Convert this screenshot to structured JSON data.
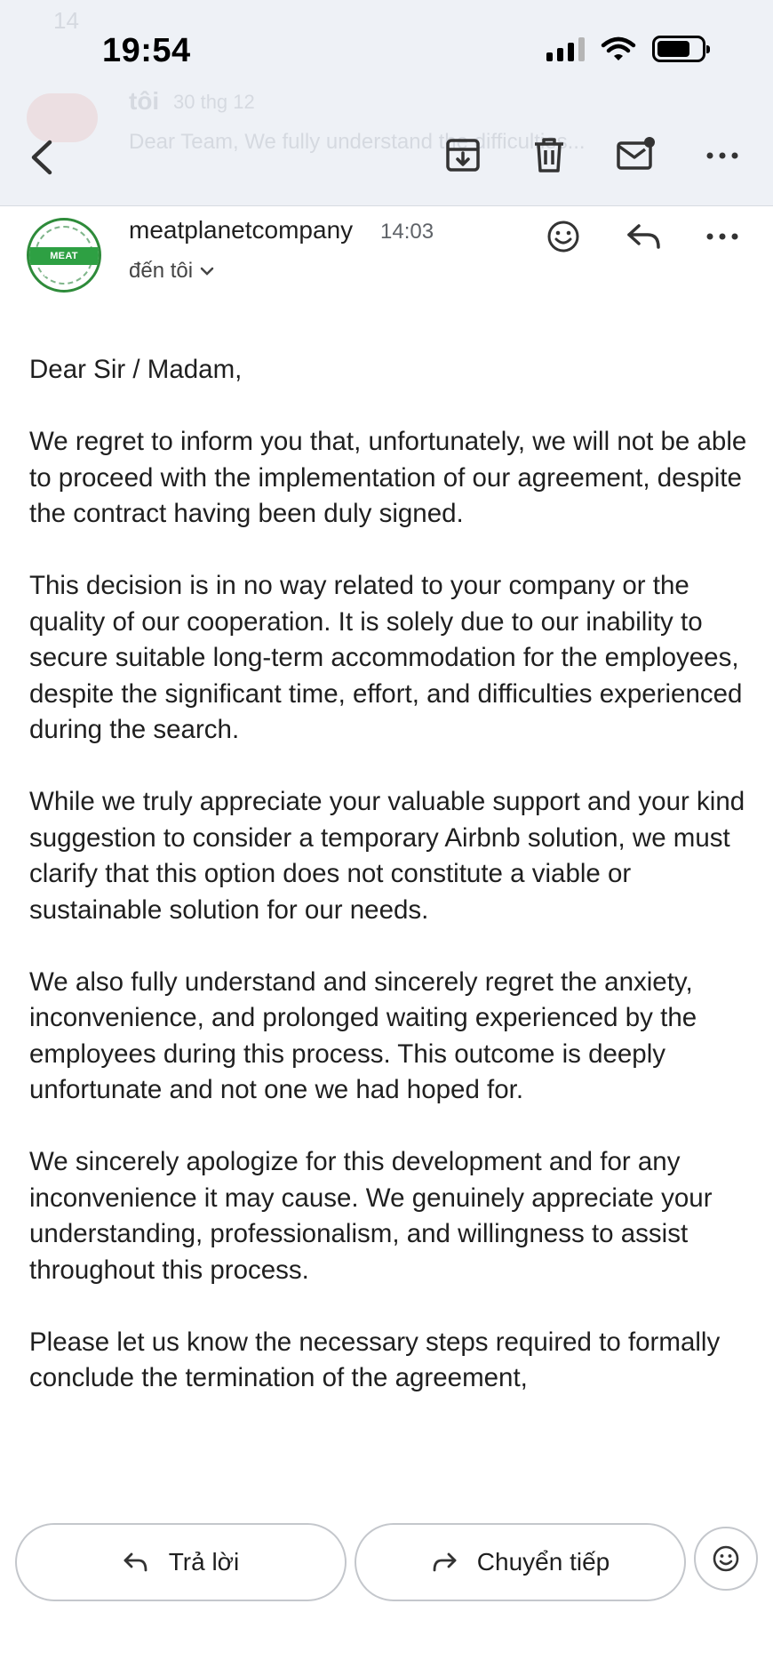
{
  "status_bar": {
    "time": "19:54"
  },
  "background_preview": {
    "count": "14",
    "sender": "tôi",
    "date": "30 thg 12",
    "snippet": "Dear Team, We fully understand the difficulties..."
  },
  "sender": {
    "name": "meatplanetcompany",
    "time": "14:03",
    "recipient_label": "đến tôi",
    "logo_text": "MEAT PLANET"
  },
  "body": {
    "paragraphs": [
      "Dear Sir / Madam,",
      "We regret to inform you that, unfortunately, we will not be able to proceed with the implementation of our agreement, despite the contract having been duly signed.",
      "This decision is in no way related to your company or the quality of our cooperation. It is solely due to our inability to secure suitable long-term accommodation for the employees, despite the significant time, effort, and difficulties experienced during the search.",
      "While we truly appreciate your valuable support and your kind suggestion to consider a temporary Airbnb solution, we must clarify that this option does not constitute a viable or sustainable solution for our needs.",
      "We also fully understand and sincerely regret the anxiety, inconvenience, and prolonged waiting experienced by the employees during this process. This outcome is deeply unfortunate and not one we had hoped for.",
      "We sincerely apologize for this development and for any inconvenience it may cause. We genuinely appreciate your understanding, professionalism, and willingness to assist throughout this process.",
      "Please let us know the necessary steps required to formally conclude the termination of the agreement,"
    ]
  },
  "actions": {
    "reply_label": "Trả lời",
    "forward_label": "Chuyển tiếp"
  },
  "icons": {
    "back": "chevron-left-icon",
    "archive": "archive-icon",
    "delete": "trash-icon",
    "mark_unread": "mail-unread-icon",
    "more": "more-horizontal-icon",
    "emoji": "emoji-icon",
    "reply": "reply-icon",
    "forward": "forward-icon"
  }
}
